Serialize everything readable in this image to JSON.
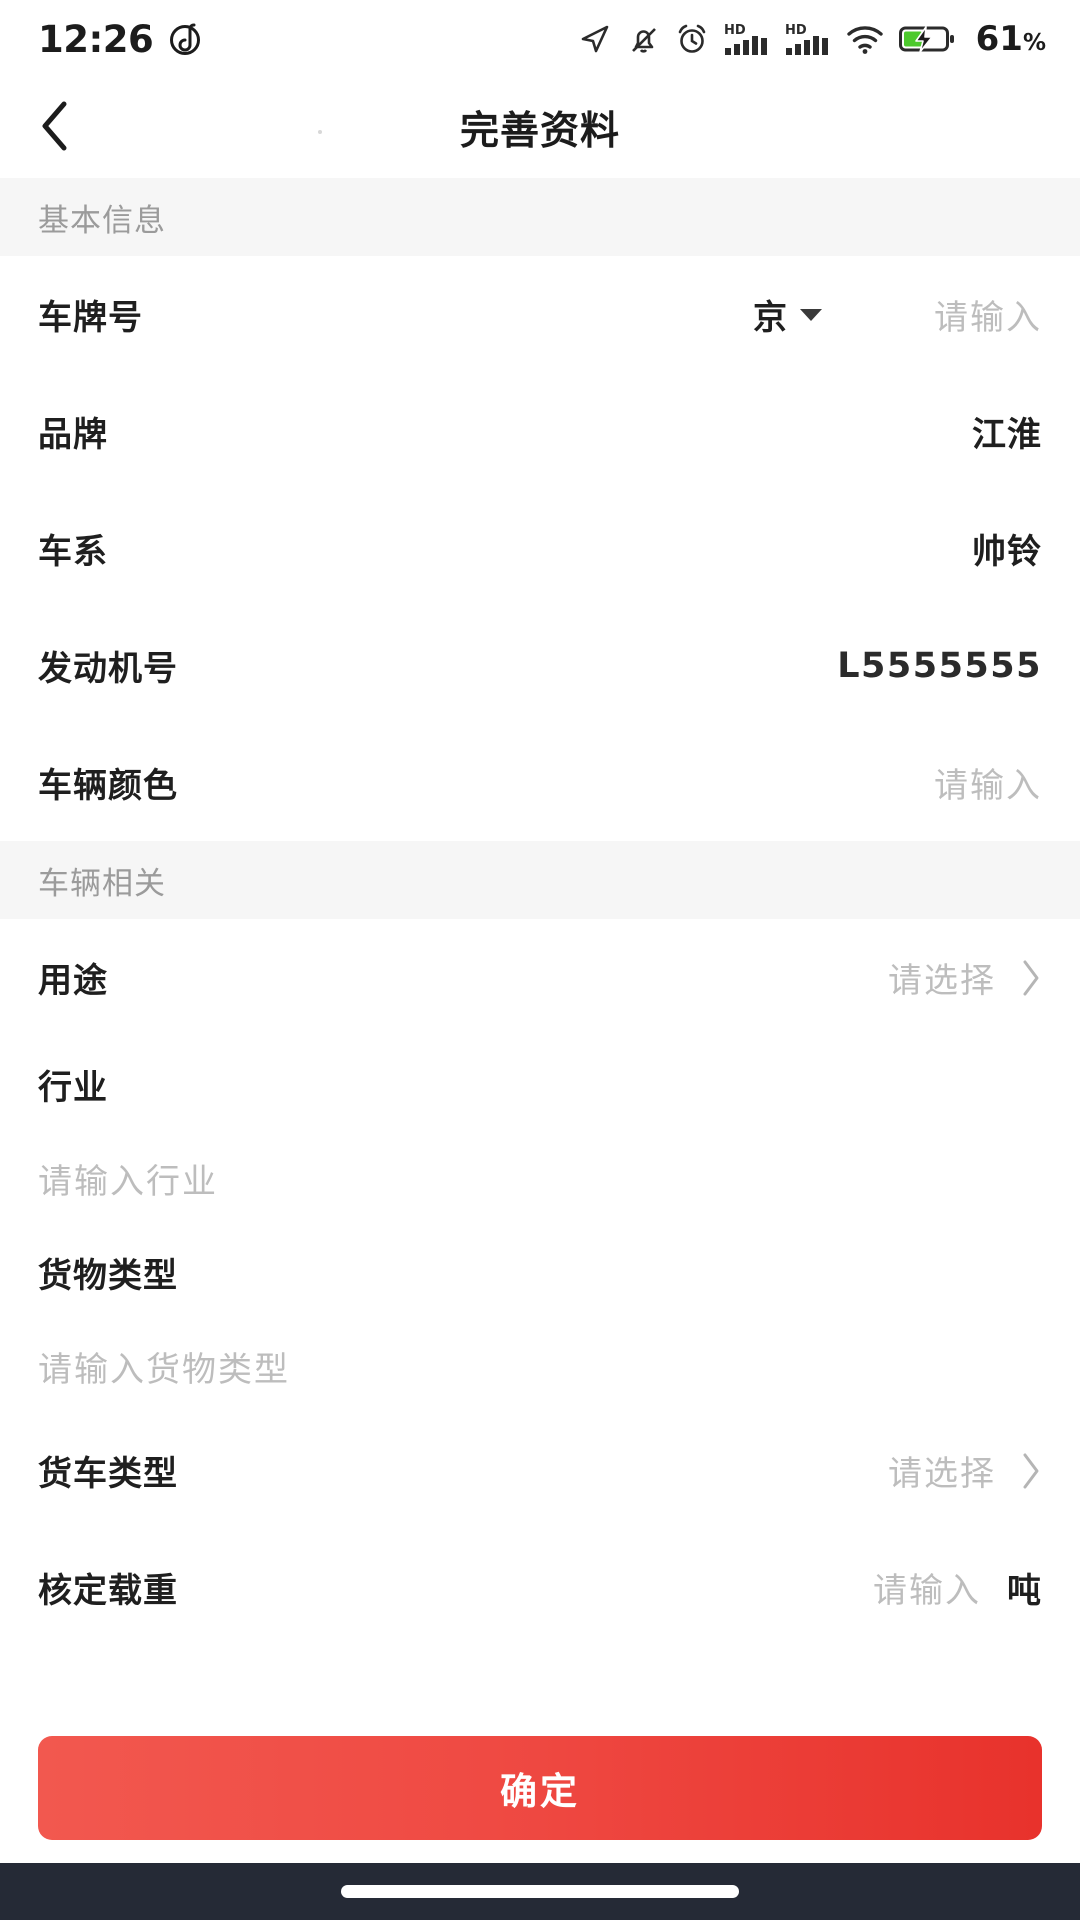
{
  "status_bar": {
    "time": "12:26",
    "music_icon": "music-circle-icon",
    "icons": [
      "navigation-arrow-icon",
      "bell-muted-icon",
      "alarm-clock-icon",
      "hd-signal-icon-1",
      "hd-signal-icon-2",
      "wifi-icon"
    ],
    "battery_level": "61",
    "battery_unit": "%",
    "battery_charging": true
  },
  "header": {
    "back_icon": "chevron-left-icon",
    "title": "完善资料"
  },
  "sections": [
    {
      "title": "基本信息",
      "rows": [
        {
          "label": "车牌号",
          "province": "京",
          "placeholder": "请输入",
          "type": "plate"
        },
        {
          "label": "品牌",
          "value": "江淮",
          "type": "value"
        },
        {
          "label": "车系",
          "value": "帅铃",
          "type": "value"
        },
        {
          "label": "发动机号",
          "value": "L5555555",
          "type": "value-mono"
        },
        {
          "label": "车辆颜色",
          "placeholder": "请输入",
          "type": "input"
        }
      ]
    },
    {
      "title": "车辆相关",
      "rows": [
        {
          "label": "用途",
          "placeholder": "请选择",
          "type": "select"
        },
        {
          "label": "行业",
          "placeholder": "请输入行业",
          "type": "block"
        },
        {
          "label": "货物类型",
          "placeholder": "请输入货物类型",
          "type": "block"
        },
        {
          "label": "货车类型",
          "placeholder": "请选择",
          "type": "select"
        },
        {
          "label": "核定载重",
          "placeholder": "请输入",
          "unit": "吨",
          "type": "input-unit"
        }
      ]
    }
  ],
  "footer": {
    "confirm_label": "确定"
  },
  "colors": {
    "accent_red_start": "#f2584f",
    "accent_red_end": "#e8322c",
    "section_bg": "#f6f6f6",
    "placeholder": "#bdbdbd",
    "text": "#1f1f1f",
    "nav_bottom": "#252a36"
  }
}
